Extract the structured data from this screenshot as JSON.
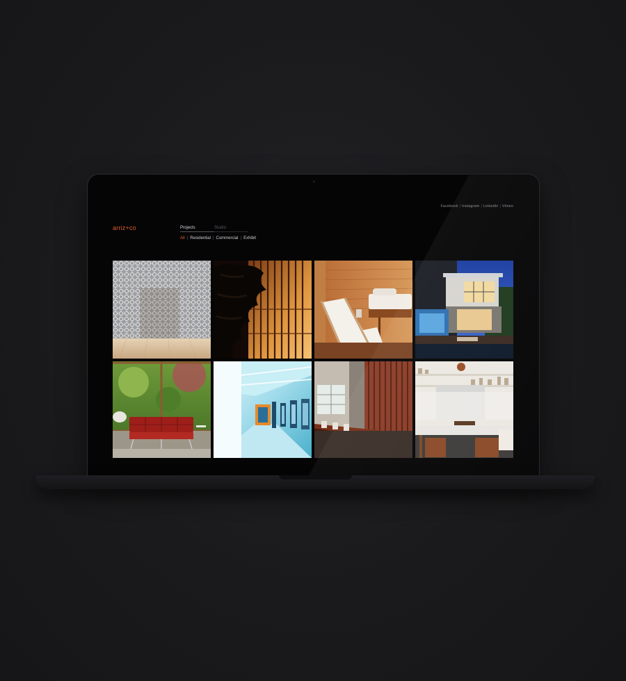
{
  "site": {
    "logo": "arriz+co",
    "social_links": [
      "Facebook",
      "Instagram",
      "LinkedIn",
      "Vimeo"
    ],
    "main_tabs": [
      {
        "label": "Projects",
        "active": true
      },
      {
        "label": "Studio",
        "active": false
      }
    ],
    "filters": [
      {
        "label": "All",
        "active": true
      },
      {
        "label": "Residential",
        "active": false
      },
      {
        "label": "Commercial",
        "active": false
      },
      {
        "label": "Exhibit",
        "active": false
      }
    ],
    "projects": [
      {
        "image": "geometric-screen-room-photo"
      },
      {
        "image": "wood-slat-facade-tree-photo"
      },
      {
        "image": "wood-interior-lounge-chair-photo"
      },
      {
        "image": "modern-house-pool-dusk-photo"
      },
      {
        "image": "red-sofa-garden-window-photo"
      },
      {
        "image": "bright-blue-gallery-corridor-photo"
      },
      {
        "image": "wood-desk-office-photo"
      },
      {
        "image": "white-kitchen-island-photo"
      }
    ]
  },
  "colors": {
    "accent": "#e05b2c",
    "page_background": "#1a1a1c",
    "screen_background": "#050506"
  }
}
